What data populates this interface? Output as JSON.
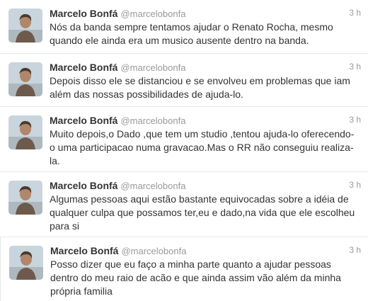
{
  "tweets": [
    {
      "fullname": "Marcelo Bonfá",
      "username": "@marcelobonfa",
      "time": "3 h",
      "avatar_icon": "profile-photo",
      "text": "Nós da banda sempre tentamos ajudar o Renato Rocha, mesmo quando ele ainda era um musico ausente dentro na banda."
    },
    {
      "fullname": "Marcelo Bonfá",
      "username": "@marcelobonfa",
      "time": "3 h",
      "avatar_icon": "profile-photo",
      "text": "Depois disso ele se distanciou e se envolveu em problemas que iam além das nossas possibilidades de ajuda-lo."
    },
    {
      "fullname": "Marcelo Bonfá",
      "username": "@marcelobonfa",
      "time": "3 h",
      "avatar_icon": "profile-photo",
      "text": "Muito depois,o Dado ,que tem um studio ,tentou ajuda-lo oferecendo-o uma participacao numa gravacao.Mas o RR não conseguiu realiza-la."
    },
    {
      "fullname": "Marcelo Bonfá",
      "username": "@marcelobonfa",
      "time": "3 h",
      "avatar_icon": "profile-photo",
      "text": "Algumas pessoas aqui estão bastante equivocadas sobre a idéia de qualquer culpa que possamos ter,eu e dado,na vida que ele escolheu para si"
    },
    {
      "fullname": "Marcelo Bonfá",
      "username": "@marcelobonfa",
      "time": "3 h",
      "avatar_icon": "profile-photo",
      "text": "Posso dizer que eu faço a minha parte quanto a ajudar pessoas dentro do meu raio de acão e que ainda assim vão além da minha própria familia"
    }
  ],
  "colors": {
    "name": "#333333",
    "meta": "#999999",
    "divider": "#e8e8e8",
    "avatar_sky": "#c7d4dc",
    "avatar_skin": "#b58a6a"
  }
}
